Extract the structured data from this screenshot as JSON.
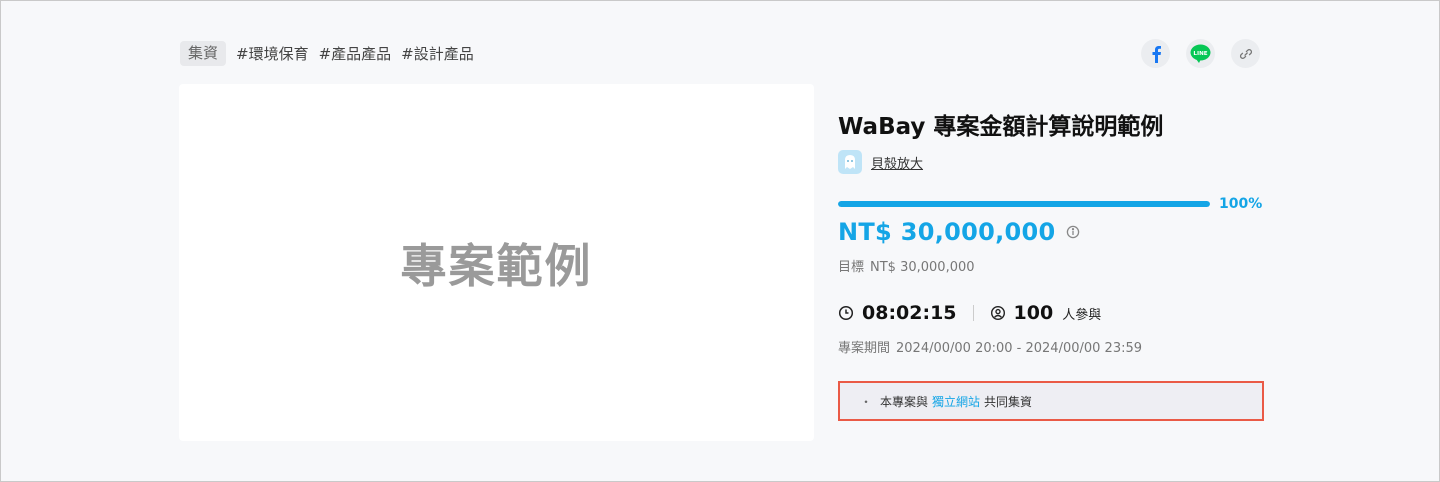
{
  "tags": {
    "category": "集資",
    "items": [
      "#環境保育",
      "#產品產品",
      "#設計產品"
    ]
  },
  "share": {
    "icons": [
      "facebook-icon",
      "line-icon",
      "link-icon"
    ],
    "line_label": "LINE"
  },
  "cover": {
    "text": "專案範例"
  },
  "project": {
    "title": "WaBay 專案金額計算說明範例",
    "creator": "貝殼放大",
    "progress": {
      "percent": 100,
      "label": "100%"
    },
    "raised": "NT$ 30,000,000",
    "goal_label": "目標",
    "goal_value": "NT$ 30,000,000",
    "time_left": "08:02:15",
    "backers": "100",
    "backers_unit": "人參與",
    "period_label": "專案期間",
    "period_value": "2024/00/00 20:00 - 2024/00/00 23:59"
  },
  "notice": {
    "bullet": "・",
    "before": "本專案與",
    "link": "獨立網站",
    "after": "共同集資"
  },
  "colors": {
    "accent": "#14a5e6",
    "notice_border": "#ea5a46",
    "facebook": "#1877f2",
    "line": "#06c755"
  }
}
